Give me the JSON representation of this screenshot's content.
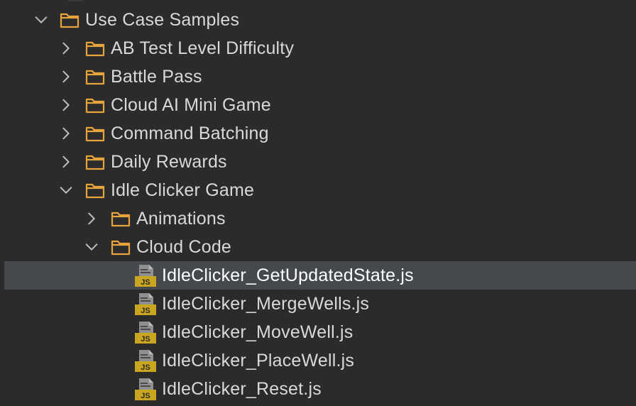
{
  "tree": {
    "root": {
      "label": "Use Case Samples",
      "expanded": true
    },
    "folders": [
      {
        "label": "AB Test Level Difficulty",
        "expanded": false
      },
      {
        "label": "Battle Pass",
        "expanded": false
      },
      {
        "label": "Cloud AI Mini Game",
        "expanded": false
      },
      {
        "label": "Command Batching",
        "expanded": false
      },
      {
        "label": "Daily Rewards",
        "expanded": false
      },
      {
        "label": "Idle Clicker Game",
        "expanded": true
      }
    ],
    "subfolders": [
      {
        "label": "Animations",
        "expanded": false
      },
      {
        "label": "Cloud Code",
        "expanded": true
      }
    ],
    "files": [
      {
        "label": "IdleClicker_GetUpdatedState.js",
        "selected": true
      },
      {
        "label": "IdleClicker_MergeWells.js",
        "selected": false
      },
      {
        "label": "IdleClicker_MoveWell.js",
        "selected": false
      },
      {
        "label": "IdleClicker_PlaceWell.js",
        "selected": false
      },
      {
        "label": "IdleClicker_Reset.js",
        "selected": false
      }
    ],
    "file_badge": "JS"
  },
  "colors": {
    "background": "#2b2b2b",
    "selection": "#45494d",
    "folder_outline": "#e8a33d",
    "js_badge": "#c9a520",
    "text": "#d9d9d9"
  }
}
